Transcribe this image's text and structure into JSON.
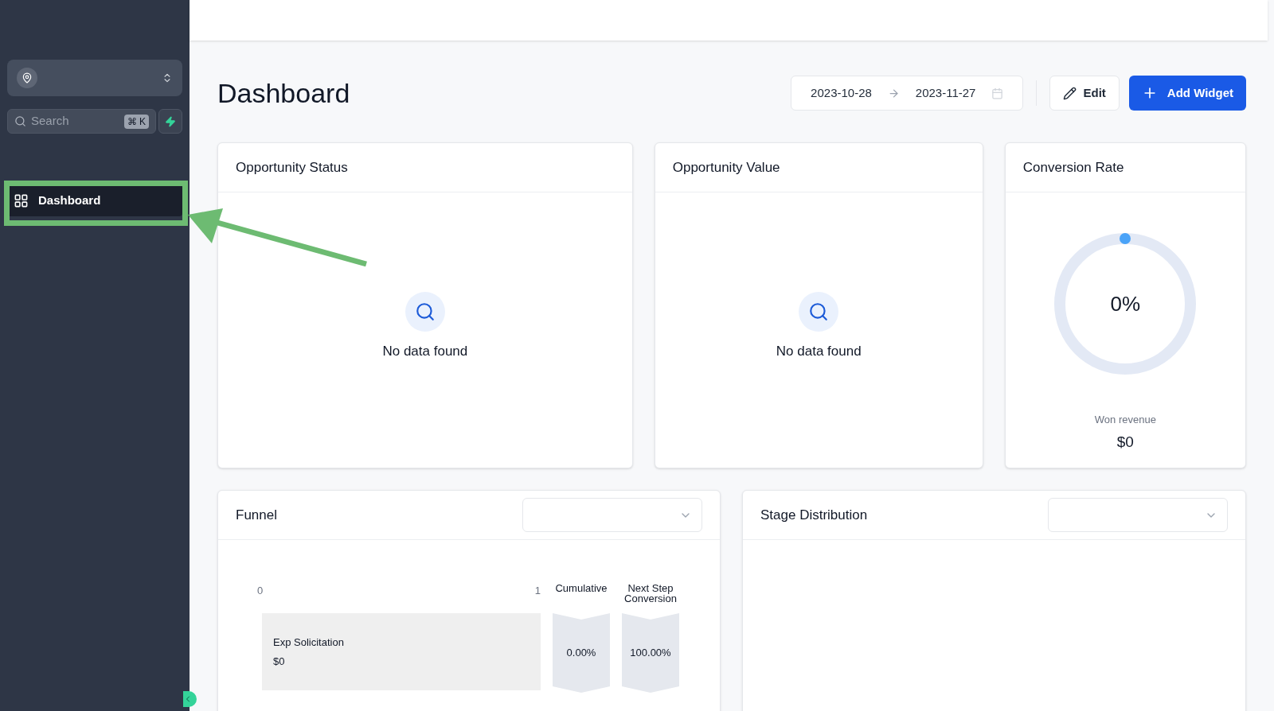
{
  "sidebar": {
    "search": {
      "placeholder": "Search",
      "shortcut": "⌘ K"
    },
    "items": [
      {
        "label": "Dashboard",
        "selected": true
      }
    ]
  },
  "header": {
    "title": "Dashboard",
    "date_range": {
      "start": "2023-10-28",
      "end": "2023-11-27"
    },
    "buttons": [
      {
        "kind": "edit",
        "label": "Edit"
      },
      {
        "kind": "add",
        "label": "Add Widget"
      }
    ]
  },
  "widgets": [
    {
      "kind": "empty",
      "title": "Opportunity Status",
      "message": "No data found"
    },
    {
      "kind": "empty",
      "title": "Opportunity Value",
      "message": "No data found"
    },
    {
      "kind": "ring",
      "title": "Conversion Rate",
      "value": "0%",
      "caption": "Won revenue",
      "amount": "$0"
    }
  ],
  "funnel": {
    "title": "Funnel",
    "axis_ticks": [
      "0",
      "1"
    ],
    "columns": [
      "Cumulative",
      "Next Step Conversion"
    ],
    "rows": [
      {
        "stage": "Exp Solicitation",
        "amount": "$0",
        "cumulative": "0.00%",
        "next_step": "100.00%"
      }
    ]
  },
  "stage_distribution": {
    "title": "Stage Distribution"
  }
}
